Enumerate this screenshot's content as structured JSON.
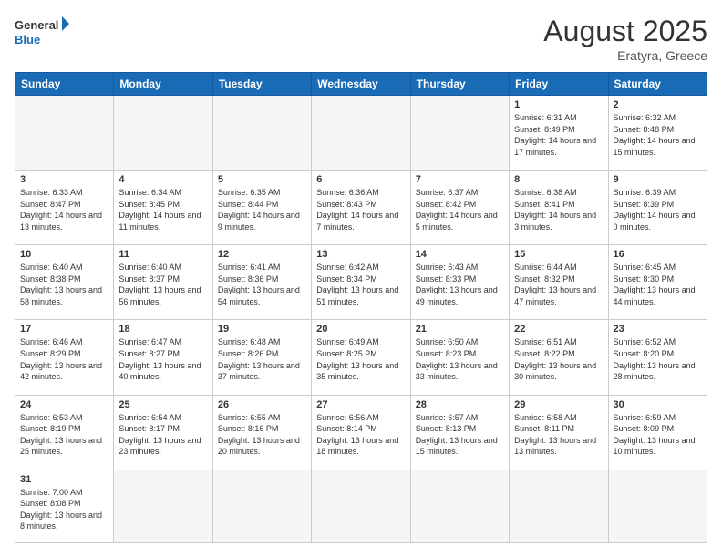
{
  "header": {
    "logo_general": "General",
    "logo_blue": "Blue",
    "month_title": "August 2025",
    "subtitle": "Eratyra, Greece"
  },
  "weekdays": [
    "Sunday",
    "Monday",
    "Tuesday",
    "Wednesday",
    "Thursday",
    "Friday",
    "Saturday"
  ],
  "weeks": [
    [
      {
        "day": "",
        "info": ""
      },
      {
        "day": "",
        "info": ""
      },
      {
        "day": "",
        "info": ""
      },
      {
        "day": "",
        "info": ""
      },
      {
        "day": "",
        "info": ""
      },
      {
        "day": "1",
        "info": "Sunrise: 6:31 AM\nSunset: 8:49 PM\nDaylight: 14 hours and 17 minutes."
      },
      {
        "day": "2",
        "info": "Sunrise: 6:32 AM\nSunset: 8:48 PM\nDaylight: 14 hours and 15 minutes."
      }
    ],
    [
      {
        "day": "3",
        "info": "Sunrise: 6:33 AM\nSunset: 8:47 PM\nDaylight: 14 hours and 13 minutes."
      },
      {
        "day": "4",
        "info": "Sunrise: 6:34 AM\nSunset: 8:45 PM\nDaylight: 14 hours and 11 minutes."
      },
      {
        "day": "5",
        "info": "Sunrise: 6:35 AM\nSunset: 8:44 PM\nDaylight: 14 hours and 9 minutes."
      },
      {
        "day": "6",
        "info": "Sunrise: 6:36 AM\nSunset: 8:43 PM\nDaylight: 14 hours and 7 minutes."
      },
      {
        "day": "7",
        "info": "Sunrise: 6:37 AM\nSunset: 8:42 PM\nDaylight: 14 hours and 5 minutes."
      },
      {
        "day": "8",
        "info": "Sunrise: 6:38 AM\nSunset: 8:41 PM\nDaylight: 14 hours and 3 minutes."
      },
      {
        "day": "9",
        "info": "Sunrise: 6:39 AM\nSunset: 8:39 PM\nDaylight: 14 hours and 0 minutes."
      }
    ],
    [
      {
        "day": "10",
        "info": "Sunrise: 6:40 AM\nSunset: 8:38 PM\nDaylight: 13 hours and 58 minutes."
      },
      {
        "day": "11",
        "info": "Sunrise: 6:40 AM\nSunset: 8:37 PM\nDaylight: 13 hours and 56 minutes."
      },
      {
        "day": "12",
        "info": "Sunrise: 6:41 AM\nSunset: 8:36 PM\nDaylight: 13 hours and 54 minutes."
      },
      {
        "day": "13",
        "info": "Sunrise: 6:42 AM\nSunset: 8:34 PM\nDaylight: 13 hours and 51 minutes."
      },
      {
        "day": "14",
        "info": "Sunrise: 6:43 AM\nSunset: 8:33 PM\nDaylight: 13 hours and 49 minutes."
      },
      {
        "day": "15",
        "info": "Sunrise: 6:44 AM\nSunset: 8:32 PM\nDaylight: 13 hours and 47 minutes."
      },
      {
        "day": "16",
        "info": "Sunrise: 6:45 AM\nSunset: 8:30 PM\nDaylight: 13 hours and 44 minutes."
      }
    ],
    [
      {
        "day": "17",
        "info": "Sunrise: 6:46 AM\nSunset: 8:29 PM\nDaylight: 13 hours and 42 minutes."
      },
      {
        "day": "18",
        "info": "Sunrise: 6:47 AM\nSunset: 8:27 PM\nDaylight: 13 hours and 40 minutes."
      },
      {
        "day": "19",
        "info": "Sunrise: 6:48 AM\nSunset: 8:26 PM\nDaylight: 13 hours and 37 minutes."
      },
      {
        "day": "20",
        "info": "Sunrise: 6:49 AM\nSunset: 8:25 PM\nDaylight: 13 hours and 35 minutes."
      },
      {
        "day": "21",
        "info": "Sunrise: 6:50 AM\nSunset: 8:23 PM\nDaylight: 13 hours and 33 minutes."
      },
      {
        "day": "22",
        "info": "Sunrise: 6:51 AM\nSunset: 8:22 PM\nDaylight: 13 hours and 30 minutes."
      },
      {
        "day": "23",
        "info": "Sunrise: 6:52 AM\nSunset: 8:20 PM\nDaylight: 13 hours and 28 minutes."
      }
    ],
    [
      {
        "day": "24",
        "info": "Sunrise: 6:53 AM\nSunset: 8:19 PM\nDaylight: 13 hours and 25 minutes."
      },
      {
        "day": "25",
        "info": "Sunrise: 6:54 AM\nSunset: 8:17 PM\nDaylight: 13 hours and 23 minutes."
      },
      {
        "day": "26",
        "info": "Sunrise: 6:55 AM\nSunset: 8:16 PM\nDaylight: 13 hours and 20 minutes."
      },
      {
        "day": "27",
        "info": "Sunrise: 6:56 AM\nSunset: 8:14 PM\nDaylight: 13 hours and 18 minutes."
      },
      {
        "day": "28",
        "info": "Sunrise: 6:57 AM\nSunset: 8:13 PM\nDaylight: 13 hours and 15 minutes."
      },
      {
        "day": "29",
        "info": "Sunrise: 6:58 AM\nSunset: 8:11 PM\nDaylight: 13 hours and 13 minutes."
      },
      {
        "day": "30",
        "info": "Sunrise: 6:59 AM\nSunset: 8:09 PM\nDaylight: 13 hours and 10 minutes."
      }
    ],
    [
      {
        "day": "31",
        "info": "Sunrise: 7:00 AM\nSunset: 8:08 PM\nDaylight: 13 hours and 8 minutes."
      },
      {
        "day": "",
        "info": ""
      },
      {
        "day": "",
        "info": ""
      },
      {
        "day": "",
        "info": ""
      },
      {
        "day": "",
        "info": ""
      },
      {
        "day": "",
        "info": ""
      },
      {
        "day": "",
        "info": ""
      }
    ]
  ]
}
